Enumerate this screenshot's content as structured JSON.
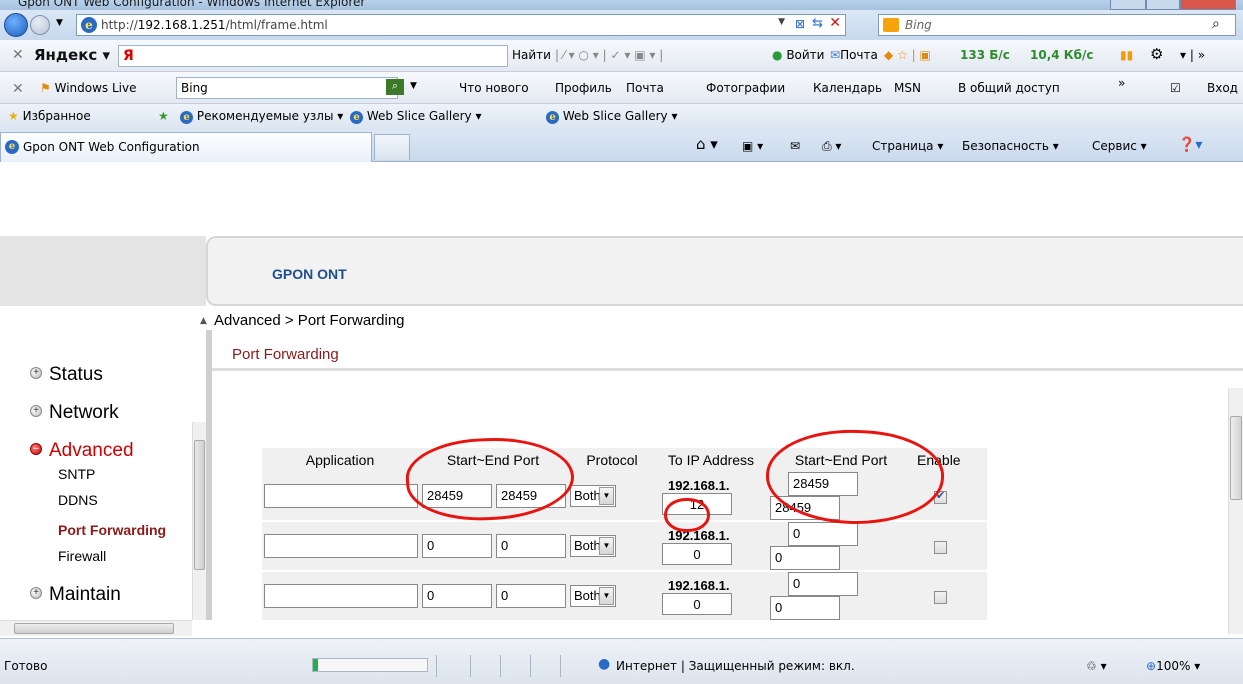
{
  "window": {
    "title": "Gpon ONT Web Configuration - Windows Internet Explorer"
  },
  "address_bar": {
    "url_prefix": "http://",
    "url_host": "192.168.1.251",
    "url_path": "/html/frame.html",
    "search_placeholder": "Bing"
  },
  "yandex_toolbar": {
    "logo": "Яндекс ▾",
    "input_value": "Я",
    "find_label": "Найти",
    "login_label": "Войти",
    "mail_label": "Почта",
    "speed_down": "133 Б/с",
    "speed_up": "10,4 Кб/с"
  },
  "live_toolbar": {
    "brand": "Windows Live",
    "search_value": "Bing",
    "links": [
      "Что нового",
      "Профиль",
      "Почта",
      "Фотографии",
      "Календарь",
      "MSN",
      "В общий доступ"
    ],
    "signin_label": "Вход"
  },
  "favorites_bar": {
    "favorites_label": "Избранное",
    "items": [
      "Рекомендуемые узлы ▾",
      "Web Slice Gallery ▾",
      "Web Slice Gallery ▾"
    ]
  },
  "tabs": {
    "active_title": "Gpon ONT Web Configuration",
    "command_items": [
      "Страница ▾",
      "Безопасность ▾",
      "Сервис ▾"
    ]
  },
  "app": {
    "brand": "GPON ONT",
    "breadcrumb": "Advanced > Port Forwarding",
    "section_title": "Port Forwarding"
  },
  "side_menu": {
    "status": "Status",
    "network": "Network",
    "advanced": "Advanced",
    "sub_items": [
      "SNTP",
      "DDNS",
      "Port Forwarding",
      "Firewall"
    ],
    "maintain": "Maintain"
  },
  "table": {
    "headers": {
      "application": "Application",
      "start_end_port": "Start~End Port",
      "protocol": "Protocol",
      "to_ip": "To IP Address",
      "start_end_port_2": "Start~End Port",
      "enable": "Enable"
    },
    "rows": [
      {
        "application": "",
        "start": "28459",
        "end": "28459",
        "protocol": "Both",
        "ip_prefix": "192.168.1.",
        "ip_last": "12",
        "to_start": "28459",
        "to_end": "28459",
        "enabled": true
      },
      {
        "application": "",
        "start": "0",
        "end": "0",
        "protocol": "Both",
        "ip_prefix": "192.168.1.",
        "ip_last": "0",
        "to_start": "0",
        "to_end": "0",
        "enabled": false
      },
      {
        "application": "",
        "start": "0",
        "end": "0",
        "protocol": "Both",
        "ip_prefix": "192.168.1.",
        "ip_last": "0",
        "to_start": "0",
        "to_end": "0",
        "enabled": false
      }
    ]
  },
  "status_bar": {
    "status_text": "Готово",
    "zone_text": "Интернет | Защищенный режим: вкл.",
    "zoom": "100%",
    "progress_fraction": 0.04
  },
  "colors": {
    "brand_blue": "#1f4e8c",
    "section_red": "#8b1a1a",
    "annotation_red": "#e8140f"
  }
}
